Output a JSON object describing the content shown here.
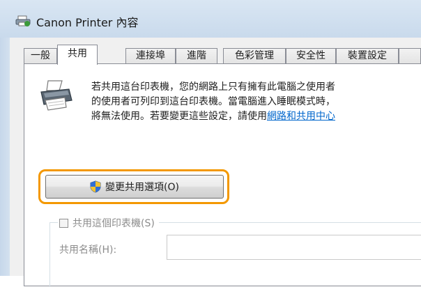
{
  "window": {
    "title": "Canon Printer 內容",
    "icon": "printer-icon"
  },
  "tabs": [
    {
      "label": "一般"
    },
    {
      "label": "共用",
      "active": true
    },
    {
      "label": "連接埠"
    },
    {
      "label": "進階"
    },
    {
      "label": "色彩管理"
    },
    {
      "label": "安全性"
    },
    {
      "label": "裝置設定"
    }
  ],
  "sharing": {
    "description_line1": "若共用這台印表機，您的網路上只有擁有此電腦之使用者",
    "description_line2": "的使用者可列印到這台印表機。當電腦進入睡眠模式時，",
    "description_line3_prefix": "將無法使用。若要變更這些設定，請使用",
    "description_link": "網路和共用中心",
    "change_button_label": "變更共用選項(O)",
    "share_checkbox_label": "共用這個印表機(S)",
    "share_checked": false,
    "share_name_label": "共用名稱(H):",
    "share_name_value": ""
  },
  "colors": {
    "highlight_ring": "#f39800",
    "link": "#0066cc",
    "title_bar": "#d9e6f3"
  }
}
